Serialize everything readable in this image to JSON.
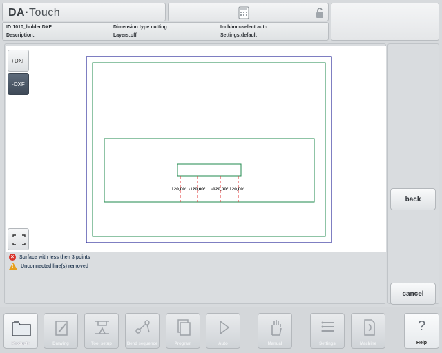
{
  "header": {
    "logo_da": "DA",
    "logo_touch": "Touch",
    "info": {
      "id": "ID:1010_holder.DXF",
      "description": "Description:",
      "dimension_type": "Dimension type:cutting",
      "layers": "Layers:off",
      "inch_mm": "Inch/mm-select:auto",
      "settings": "Settings:default"
    }
  },
  "side_buttons": {
    "plus_dxf": "+DXF",
    "minus_dxf": "-DXF"
  },
  "drawing": {
    "labels": [
      "120,00°",
      "-120,00°",
      "-120,00°",
      "120,00°"
    ]
  },
  "messages": [
    {
      "type": "error",
      "text": "Surface with less then 3 points"
    },
    {
      "type": "warning",
      "text": "Unconnected line(s) removed"
    }
  ],
  "right_buttons": {
    "back": "back",
    "cancel": "cancel"
  },
  "nav": [
    {
      "label": "Products",
      "icon": "folder-icon"
    },
    {
      "label": "Drawing",
      "icon": "pencil-icon"
    },
    {
      "label": "Tool setup",
      "icon": "tool-icon"
    },
    {
      "label": "Bend sequence",
      "icon": "sequence-icon"
    },
    {
      "label": "Program",
      "icon": "pages-icon"
    },
    {
      "label": "Auto",
      "icon": "play-icon"
    },
    {
      "label": "Manual",
      "icon": "hand-icon"
    },
    {
      "label": "Settings",
      "icon": "list-icon"
    },
    {
      "label": "Machine",
      "icon": "machine-icon"
    }
  ],
  "help": {
    "label": "Help",
    "glyph": "?"
  },
  "colors": {
    "outer_frame": "#2a2a9a",
    "contour": "#1f8a4c",
    "bend_line": "#e03030"
  }
}
